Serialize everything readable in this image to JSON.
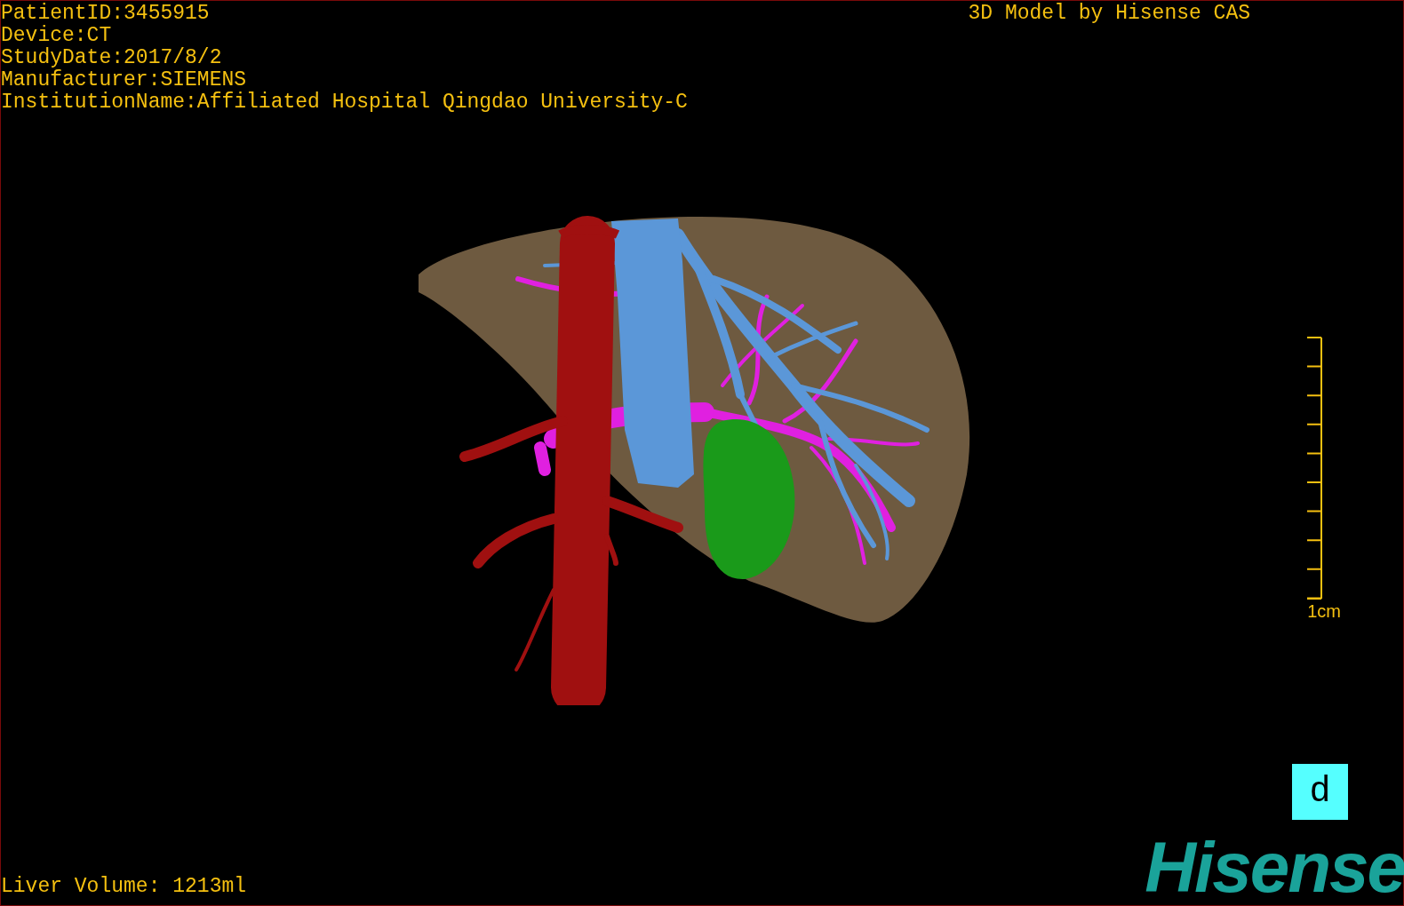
{
  "info_lines": [
    "PatientID:3455915",
    "Device:CT",
    "StudyDate:2017/8/2",
    "Manufacturer:SIEMENS",
    "InstitutionName:Affiliated Hospital Qingdao University-C"
  ],
  "title": "3D Model by Hisense CAS",
  "scale_bar": {
    "label": "1cm"
  },
  "orientation_cube": {
    "face_label": "d"
  },
  "liver_volume": "Liver Volume: 1213ml",
  "logo": "Hisense"
}
